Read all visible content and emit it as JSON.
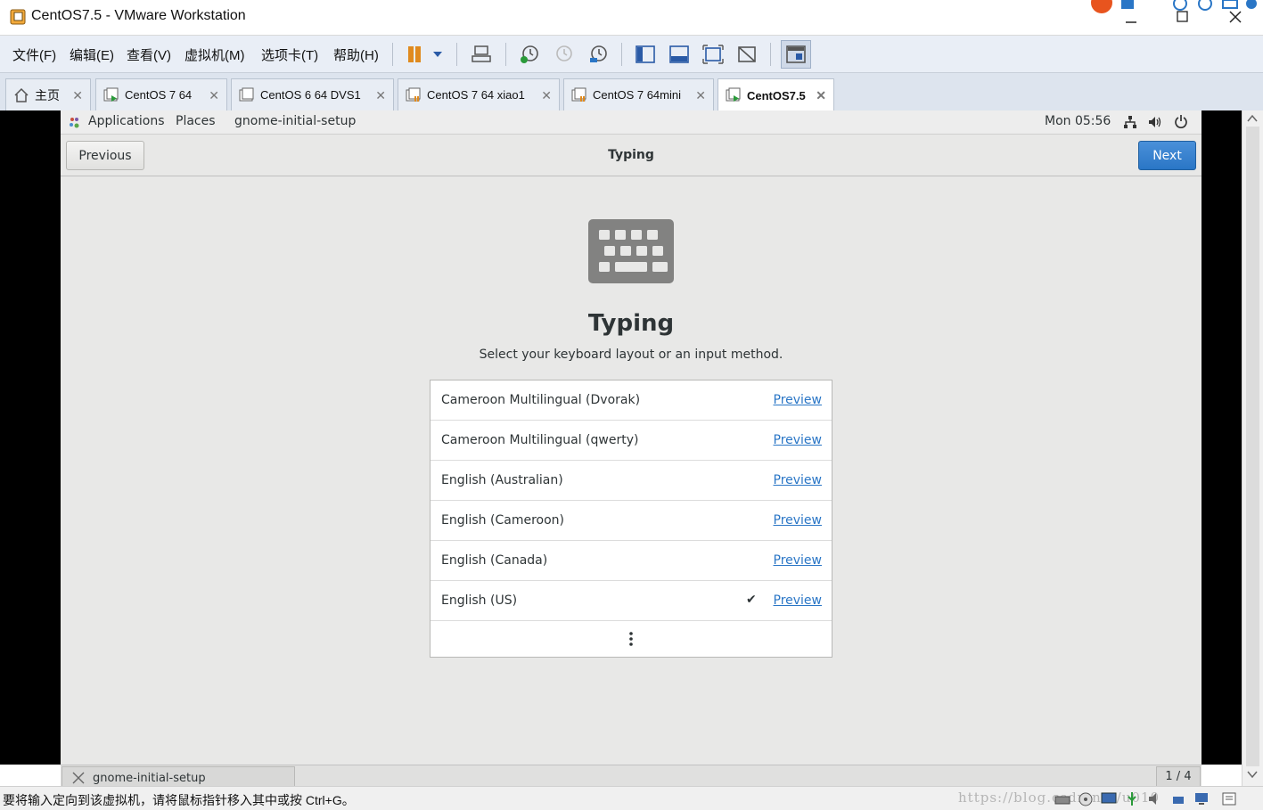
{
  "window": {
    "title": "CentOS7.5 - VMware Workstation"
  },
  "menu": {
    "items": [
      "文件(F)",
      "编辑(E)",
      "查看(V)",
      "虚拟机(M)",
      "选项卡(T)",
      "帮助(H)"
    ]
  },
  "tabs": [
    {
      "label": "主页",
      "icon": "home-icon"
    },
    {
      "label": "CentOS 7 64",
      "icon": "vm-running-icon"
    },
    {
      "label": "CentOS 6 64 DVS1",
      "icon": "vm-icon"
    },
    {
      "label": "CentOS 7 64 xiao1",
      "icon": "vm-paused-icon"
    },
    {
      "label": "CentOS 7 64mini",
      "icon": "vm-paused-icon"
    },
    {
      "label": "CentOS7.5",
      "icon": "vm-running-icon",
      "active": true
    }
  ],
  "gnome_topbar": {
    "applications": "Applications",
    "places": "Places",
    "app_name": "gnome-initial-setup",
    "clock": "Mon 05:56"
  },
  "header": {
    "previous": "Previous",
    "title": "Typing",
    "next": "Next"
  },
  "page": {
    "heading": "Typing",
    "subtitle": "Select your keyboard layout or an input method."
  },
  "layouts": [
    {
      "name": "Cameroon Multilingual (Dvorak)",
      "action": "Preview",
      "selected": false
    },
    {
      "name": "Cameroon Multilingual (qwerty)",
      "action": "Preview",
      "selected": false
    },
    {
      "name": "English (Australian)",
      "action": "Preview",
      "selected": false
    },
    {
      "name": "English (Cameroon)",
      "action": "Preview",
      "selected": false
    },
    {
      "name": "English (Canada)",
      "action": "Preview",
      "selected": false
    },
    {
      "name": "English (US)",
      "action": "Preview",
      "selected": true,
      "check": "✔"
    }
  ],
  "gnome_bottom": {
    "task": "gnome-initial-setup",
    "workspace": "1 / 4"
  },
  "statusbar": {
    "message": "要将输入定向到该虚拟机，请将鼠标指针移入其中或按 Ctrl+G。",
    "watermark": "https://blog.csdn.net/u010"
  },
  "colors": {
    "accent": "#2a76c6",
    "gnome_bg": "#e8e8e7",
    "vmware_toolbar": "#e9eef6"
  }
}
